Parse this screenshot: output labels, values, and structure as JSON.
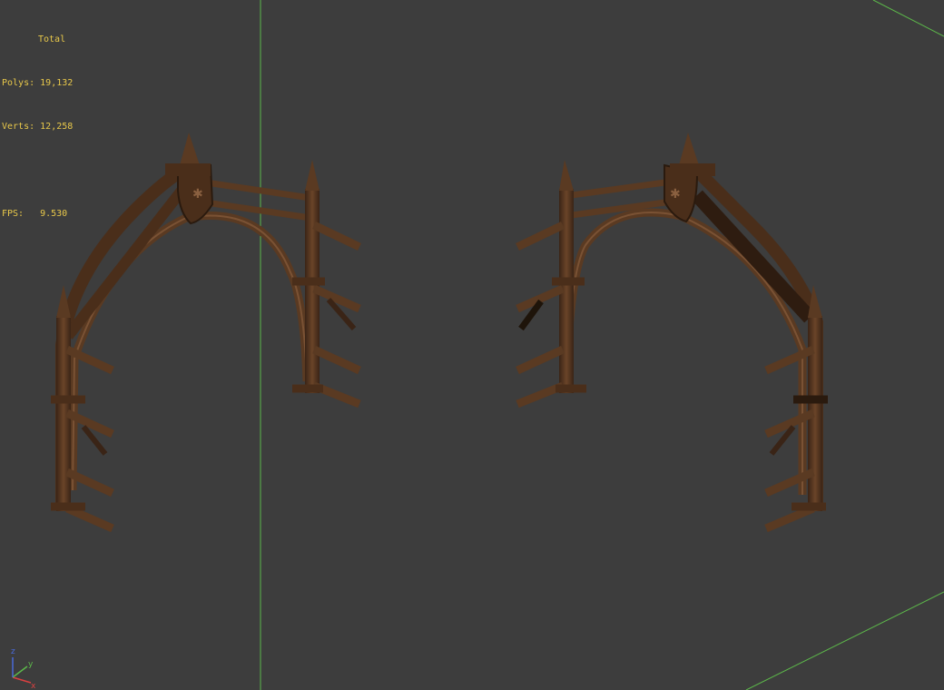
{
  "stats": {
    "total_label": "Total",
    "polys_label": "Polys:",
    "polys_value": "19,132",
    "verts_label": "Verts:",
    "verts_value": "12,258",
    "fps_label": "FPS:",
    "fps_value": "9.530"
  },
  "gizmo": {
    "x_label": "x",
    "y_label": "y",
    "z_label": "z"
  },
  "colors": {
    "background": "#3d3d3d",
    "grid_line": "#5cb84a",
    "stats_text": "#e8c84a",
    "wood_dark": "#3a2416",
    "wood_mid": "#5a3a24",
    "wood_light": "#7a5234"
  }
}
